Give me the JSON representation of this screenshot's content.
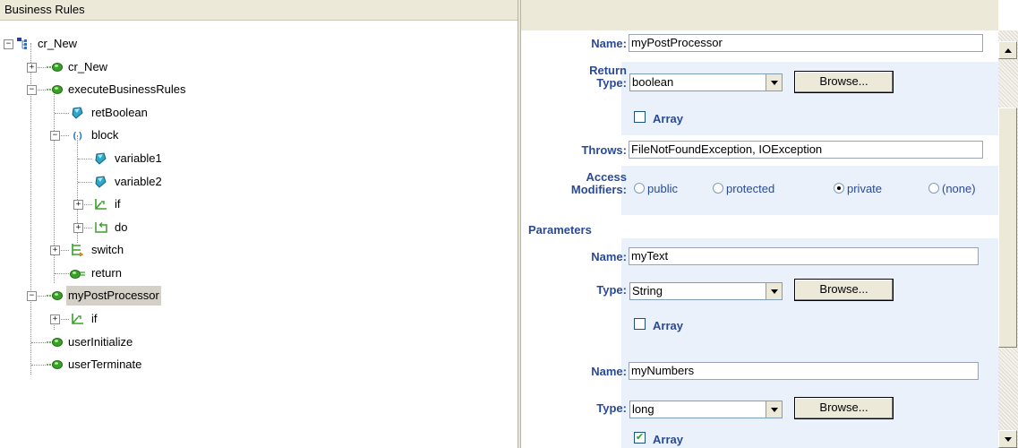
{
  "left_panel": {
    "header": "Business Rules"
  },
  "tree": [
    {
      "label": "cr_New",
      "icon": "rules-root-icon"
    },
    {
      "label": "cr_New",
      "icon": "method-icon"
    },
    {
      "label": "executeBusinessRules",
      "icon": "method-icon"
    },
    {
      "label": "retBoolean",
      "icon": "variable-icon"
    },
    {
      "label": "block",
      "icon": "block-braces-icon"
    },
    {
      "label": "variable1",
      "icon": "variable-icon"
    },
    {
      "label": "variable2",
      "icon": "variable-icon"
    },
    {
      "label": "if",
      "icon": "if-branch-icon"
    },
    {
      "label": "do",
      "icon": "loop-icon"
    },
    {
      "label": "switch",
      "icon": "switch-icon"
    },
    {
      "label": "return",
      "icon": "return-icon"
    },
    {
      "label": "myPostProcessor",
      "icon": "method-icon",
      "selected": true
    },
    {
      "label": "if",
      "icon": "if-branch-icon"
    },
    {
      "label": "userInitialize",
      "icon": "method-icon"
    },
    {
      "label": "userTerminate",
      "icon": "method-icon"
    }
  ],
  "form": {
    "name_label": "Name:",
    "name_value": "myPostProcessor",
    "return_type_label_1": "Return",
    "return_type_label_2": "Type:",
    "return_type_value": "boolean",
    "browse_label": "Browse...",
    "array_label": "Array",
    "return_array_checked": false,
    "throws_label": "Throws:",
    "throws_value": "FileNotFoundException, IOException",
    "access_label_1": "Access",
    "access_label_2": "Modifiers:",
    "access_options": [
      "public",
      "protected",
      "private",
      "(none)"
    ],
    "access_selected": "private",
    "parameters_heading": "Parameters",
    "type_label": "Type:",
    "parameters": [
      {
        "name": "myText",
        "type": "String",
        "array": false
      },
      {
        "name": "myNumbers",
        "type": "long",
        "array": true
      }
    ]
  },
  "colors": {
    "label_blue": "#2b4a96",
    "band_bg": "#eaf1fb",
    "chrome": "#ece9d8",
    "icon_green": "#3aa02a"
  }
}
